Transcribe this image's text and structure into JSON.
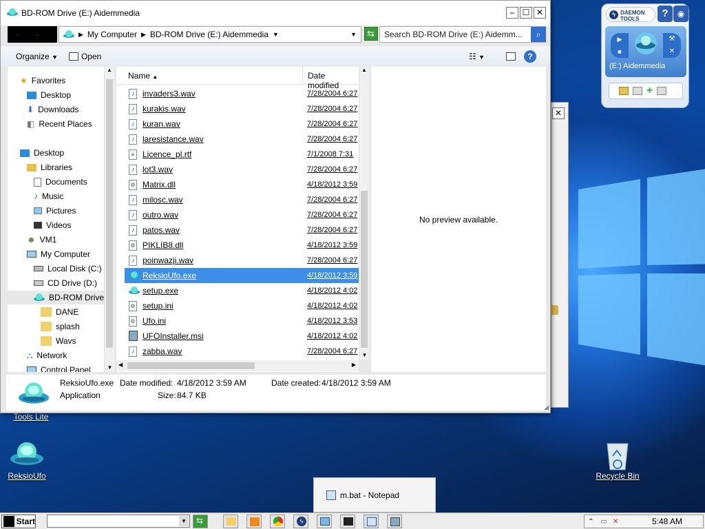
{
  "explorer": {
    "title": "BD-ROM Drive (E:) Aidemmedia",
    "breadcrumb": [
      "My Computer",
      "BD-ROM Drive (E:) Aidemmedia"
    ],
    "search_placeholder": "Search BD-ROM Drive (E:) Aidemm...",
    "toolbar": {
      "organize": "Organize",
      "open": "Open"
    },
    "nav": [
      {
        "label": "Favorites",
        "icon": "star-icon"
      },
      {
        "label": "Desktop",
        "icon": "desktop-icon"
      },
      {
        "label": "Downloads",
        "icon": "downloads-icon"
      },
      {
        "label": "Recent Places",
        "icon": "recent-places-icon"
      },
      {
        "label": "Desktop",
        "icon": "desktop-icon"
      },
      {
        "label": "Libraries",
        "icon": "libraries-icon"
      },
      {
        "label": "Documents",
        "icon": "documents-icon"
      },
      {
        "label": "Music",
        "icon": "music-icon"
      },
      {
        "label": "Pictures",
        "icon": "pictures-icon"
      },
      {
        "label": "Videos",
        "icon": "videos-icon"
      },
      {
        "label": "VM1",
        "icon": "user-icon"
      },
      {
        "label": "My Computer",
        "icon": "computer-icon"
      },
      {
        "label": "Local Disk (C:)",
        "icon": "disk-icon"
      },
      {
        "label": "CD Drive (D:)",
        "icon": "cd-drive-icon"
      },
      {
        "label": "BD-ROM Drive",
        "icon": "bd-rom-icon"
      },
      {
        "label": "DANE",
        "icon": "folder-icon"
      },
      {
        "label": "splash",
        "icon": "folder-icon"
      },
      {
        "label": "Wavs",
        "icon": "folder-icon"
      },
      {
        "label": "Network",
        "icon": "network-icon"
      },
      {
        "label": "Control Panel",
        "icon": "control-panel-icon"
      }
    ],
    "columns": {
      "name": "Name",
      "date": "Date modified"
    },
    "files": [
      {
        "name": "invaders3.wav",
        "date": "7/28/2004 6:27",
        "icon": "audio-file-icon"
      },
      {
        "name": "kurakis.wav",
        "date": "7/28/2004 6:27",
        "icon": "audio-file-icon"
      },
      {
        "name": "kuran.wav",
        "date": "7/28/2004 6:27",
        "icon": "audio-file-icon"
      },
      {
        "name": "laresistance.wav",
        "date": "7/28/2004 6:27",
        "icon": "audio-file-icon"
      },
      {
        "name": "Licence_pl.rtf",
        "date": "7/1/2008 7:31",
        "icon": "document-file-icon"
      },
      {
        "name": "lot3.wav",
        "date": "7/28/2004 6:27",
        "icon": "audio-file-icon"
      },
      {
        "name": "Matrix.dll",
        "date": "4/18/2012 3:59",
        "icon": "dll-file-icon"
      },
      {
        "name": "milosc.wav",
        "date": "7/28/2004 6:27",
        "icon": "audio-file-icon"
      },
      {
        "name": "outro.wav",
        "date": "7/28/2004 6:27",
        "icon": "audio-file-icon"
      },
      {
        "name": "patos.wav",
        "date": "7/28/2004 6:27",
        "icon": "audio-file-icon"
      },
      {
        "name": "PIKLIB8.dll",
        "date": "4/18/2012 3:59",
        "icon": "dll-file-icon"
      },
      {
        "name": "poinwazji.wav",
        "date": "7/28/2004 6:27",
        "icon": "audio-file-icon"
      },
      {
        "name": "ReksioUfo.exe",
        "date": "4/18/2012 3:59",
        "icon": "ufo-app-icon",
        "selected": true
      },
      {
        "name": "setup.exe",
        "date": "4/18/2012 4:02",
        "icon": "ufo-app-icon"
      },
      {
        "name": "setup.ini",
        "date": "4/18/2012 4:02",
        "icon": "ini-file-icon"
      },
      {
        "name": "Ufo.ini",
        "date": "4/18/2012 3:53",
        "icon": "ini-file-icon"
      },
      {
        "name": "UFOInstaller.msi",
        "date": "4/18/2012 4:02",
        "icon": "installer-file-icon"
      },
      {
        "name": "zabba.wav",
        "date": "7/28/2004 6:27",
        "icon": "audio-file-icon"
      }
    ],
    "preview_text": "No preview available.",
    "details": {
      "name": "ReksioUfo.exe",
      "type": "Application",
      "modified_label": "Date modified:",
      "modified": "4/18/2012 3:59 AM",
      "created_label": "Date created:",
      "created": "4/18/2012 3:59 AM",
      "size_label": "Size:",
      "size": "84.7 KB"
    }
  },
  "daemon": {
    "brand": "DAEMON TOOLS",
    "drive": "(E:) Aidemmedia"
  },
  "desktop": {
    "icons": [
      {
        "label": "Tools Lite"
      },
      {
        "label": "ReksioUfo"
      },
      {
        "label": "Recycle Bin"
      }
    ]
  },
  "notepad_popup": {
    "label": "m.bat - Notepad"
  },
  "taskbar": {
    "start": "Start",
    "clock": "5:48 AM"
  }
}
